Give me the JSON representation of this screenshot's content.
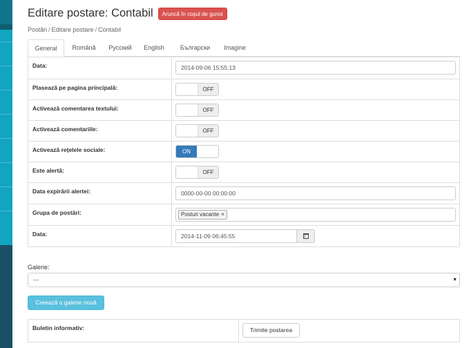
{
  "header": {
    "title": "Editare postare: Contabil",
    "trash_label": "Aruncă în coșul de gunoi"
  },
  "breadcrumb": {
    "items": [
      "Postări",
      "Editare postare",
      "Contabil"
    ],
    "separator": "/"
  },
  "tabs": [
    {
      "label": "General",
      "active": true
    },
    {
      "label": "Română",
      "active": false
    },
    {
      "label": "Русский",
      "active": false
    },
    {
      "label": "English",
      "active": false
    },
    {
      "label": "Български",
      "active": false
    },
    {
      "label": "Imagine",
      "active": false
    }
  ],
  "form": {
    "rows": [
      {
        "label": "Data:",
        "type": "text",
        "value": "2014-09-06 15:55:13"
      },
      {
        "label": "Plasează pe pagina principală:",
        "type": "switch",
        "state": "OFF"
      },
      {
        "label": "Activează comentarea textului:",
        "type": "switch",
        "state": "OFF"
      },
      {
        "label": "Activează comentariile:",
        "type": "switch",
        "state": "OFF"
      },
      {
        "label": "Activează rețelele sociale:",
        "type": "switch",
        "state": "ON"
      },
      {
        "label": "Este alertă:",
        "type": "switch",
        "state": "OFF"
      },
      {
        "label": "Data expirării alertei:",
        "type": "text",
        "value": "0000-00-00 00:00:00"
      },
      {
        "label": "Grupa de postări:",
        "type": "tags",
        "tags": [
          {
            "label": "Posturi vacante",
            "remove": "×"
          }
        ]
      },
      {
        "label": "Data:",
        "type": "date",
        "value": "2014-11-09 06:45:55",
        "icon": "calendar-icon"
      }
    ]
  },
  "gallery": {
    "label": "Galerie:",
    "selected": "---",
    "caret": "▼",
    "new_button": "Creează o galerie nouă"
  },
  "newsletter": {
    "label": "Buletin informativ:",
    "send_button": "Trimite postarea"
  },
  "colors": {
    "danger": "#d9534f",
    "primary": "#337ab7",
    "info": "#5bc0de",
    "sidebar": "#11a5c1"
  }
}
